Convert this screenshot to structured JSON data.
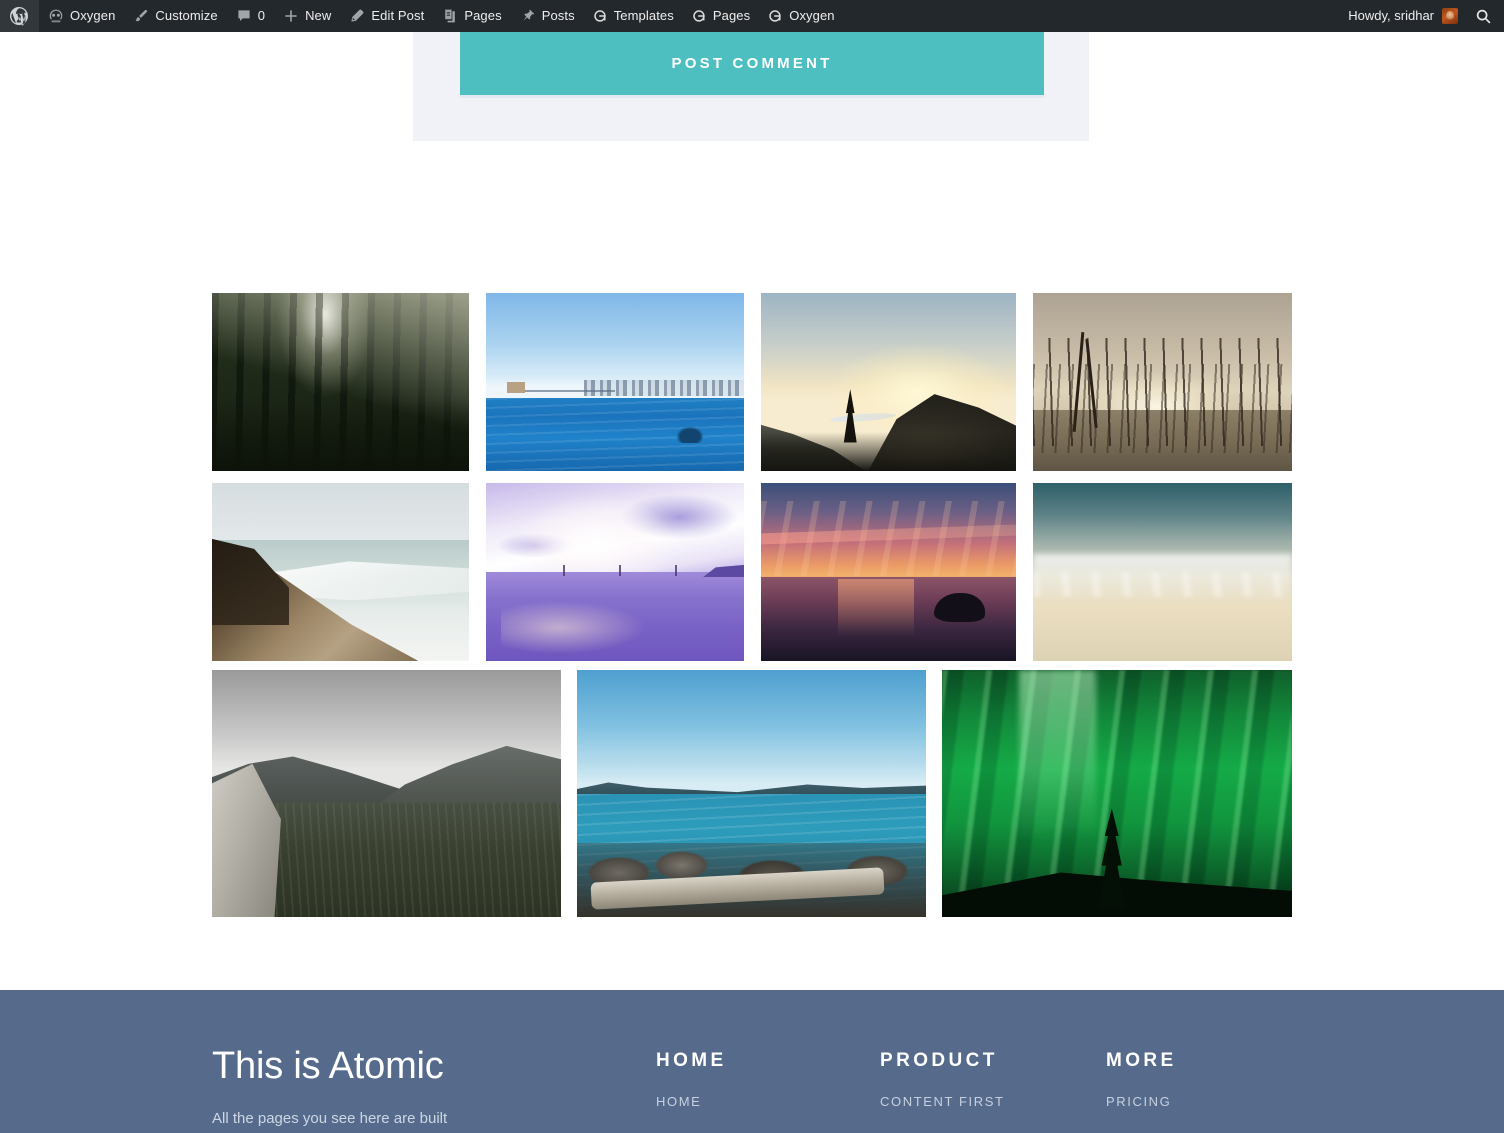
{
  "adminbar": {
    "wp_logo_label": "WordPress",
    "items": [
      {
        "id": "oxygen-site",
        "icon": "oxygen-icon",
        "label": "Oxygen"
      },
      {
        "id": "customize",
        "icon": "brush-icon",
        "label": "Customize"
      },
      {
        "id": "comments",
        "icon": "comment-icon",
        "label": "0"
      },
      {
        "id": "new",
        "icon": "plus-icon",
        "label": "New"
      },
      {
        "id": "edit-post",
        "icon": "pencil-icon",
        "label": "Edit Post"
      },
      {
        "id": "pages-1",
        "icon": "pages-icon",
        "label": "Pages"
      },
      {
        "id": "posts",
        "icon": "pin-icon",
        "label": "Posts"
      },
      {
        "id": "templates",
        "icon": "oxygen-q-icon",
        "label": "Templates"
      },
      {
        "id": "pages-2",
        "icon": "oxygen-q-icon",
        "label": "Pages"
      },
      {
        "id": "oxygen-2",
        "icon": "oxygen-q-icon",
        "label": "Oxygen"
      }
    ],
    "howdy": "Howdy, sridhar",
    "avatar_alt": "avatar",
    "search_icon": "search-icon",
    "bg_color": "#23282d"
  },
  "comment_form": {
    "submit_label": "POST COMMENT",
    "button_color": "#4ebfc0",
    "panel_color": "#f0f2f8"
  },
  "gallery": {
    "items": [
      {
        "id": "img-forest-sunbeams",
        "alt": "Sunbeams through a dark pine forest"
      },
      {
        "id": "img-bay-skyline",
        "alt": "Kayaker on blue bay with city skyline"
      },
      {
        "id": "img-ridge-sunrise",
        "alt": "Sunrise over a ridge with a winding river"
      },
      {
        "id": "img-burned-forest",
        "alt": "Burned forest of bare trunks in sepia haze"
      },
      {
        "id": "img-coast-cliff",
        "alt": "Rocky cliff above a pale breaking surf"
      },
      {
        "id": "img-purple-bridge",
        "alt": "Purple sunset over a bay with bridge towers"
      },
      {
        "id": "img-ocean-sunset",
        "alt": "Orange ocean sunset with a small islet"
      },
      {
        "id": "img-teal-clouds",
        "alt": "Pale cloud band under a teal sky"
      },
      {
        "id": "img-grey-valley",
        "alt": "Grey misty valley with a boulder in foreground"
      },
      {
        "id": "img-turquoise-lake",
        "alt": "Turquoise lake with rocks and driftwood"
      },
      {
        "id": "img-aurora",
        "alt": "Green aurora borealis above a lone tree"
      }
    ]
  },
  "footer": {
    "bg_color": "#566b8c",
    "brand": "This is Atomic",
    "tagline": "All the pages you see here are built",
    "columns": [
      {
        "id": "home",
        "heading": "HOME",
        "links": [
          "HOME"
        ]
      },
      {
        "id": "product",
        "heading": "PRODUCT",
        "links": [
          "CONTENT FIRST"
        ]
      },
      {
        "id": "more",
        "heading": "MORE",
        "links": [
          "PRICING"
        ]
      }
    ]
  }
}
